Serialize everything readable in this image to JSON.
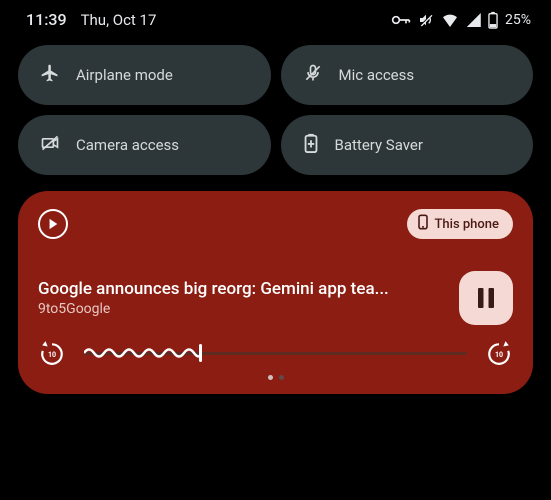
{
  "status": {
    "time": "11:39",
    "date": "Thu, Oct 17",
    "battery_text": "25%"
  },
  "qs": {
    "tiles": [
      {
        "label": "Airplane mode"
      },
      {
        "label": "Mic access"
      },
      {
        "label": "Camera access"
      },
      {
        "label": "Battery Saver"
      }
    ]
  },
  "media": {
    "device_label": "This phone",
    "title": "Google announces big reorg: Gemini app tea...",
    "subtitle": "9to5Google",
    "progress_pct": 30,
    "rewind_label": "10",
    "forward_label": "10"
  }
}
